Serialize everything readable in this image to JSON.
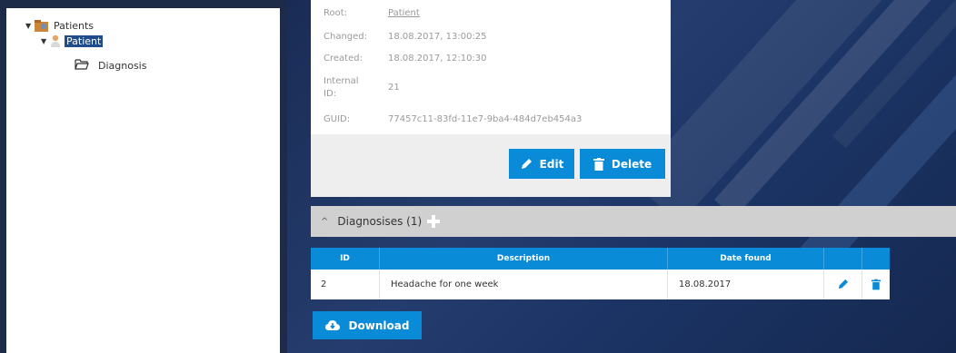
{
  "tree": {
    "root_label": "Patients",
    "child_label": "Patient",
    "grandchild_label": "Diagnosis"
  },
  "details": {
    "rows": [
      {
        "label": "Root:",
        "value": "Patient"
      },
      {
        "label": "Changed:",
        "value": "18.08.2017, 13:00:25"
      },
      {
        "label": "Created:",
        "value": "18.08.2017, 12:10:30"
      },
      {
        "label": "Internal ID:",
        "value": "21"
      },
      {
        "label": "GUID:",
        "value": "77457c11-83fd-11e7-9ba4-484d7eb454a3"
      }
    ],
    "edit_label": "Edit",
    "delete_label": "Delete"
  },
  "diagnosises": {
    "title": "Diagnosises (1)",
    "columns": [
      "ID",
      "Description",
      "Date found"
    ],
    "rows": [
      {
        "id": "2",
        "description": "Headache for one week",
        "date": "18.08.2017"
      }
    ]
  },
  "download_label": "Download",
  "colors": {
    "accent": "#0a8bd8",
    "tree_selected": "#1f4c8c",
    "background": "#22345a"
  },
  "icons": [
    "folder-icon",
    "person-icon",
    "open-folder-icon",
    "pencil-icon",
    "trash-icon",
    "chevron-up-icon",
    "plus-icon",
    "cloud-download-icon"
  ]
}
